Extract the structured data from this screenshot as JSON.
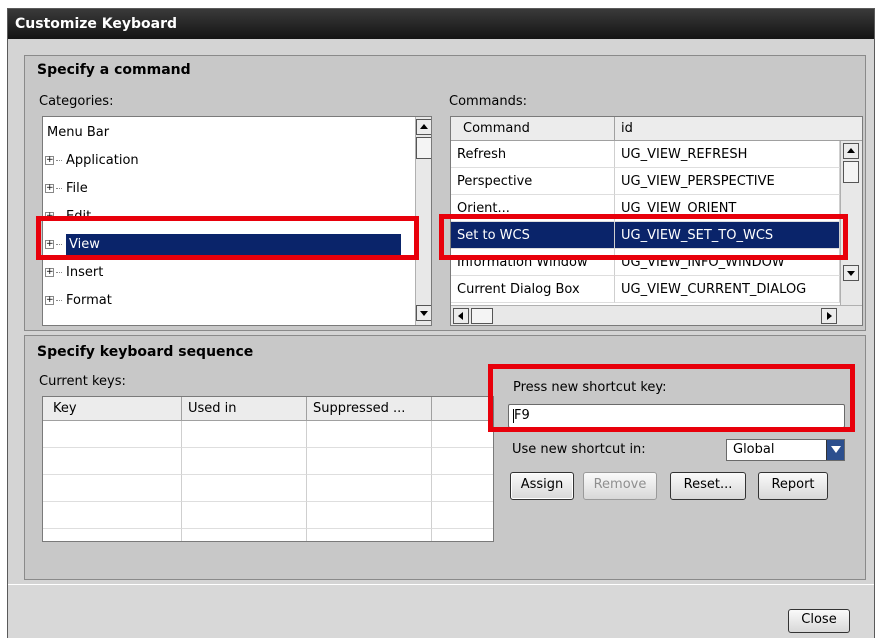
{
  "window": {
    "title": "Customize Keyboard"
  },
  "command_group": {
    "title": "Specify a command",
    "categories_label": "Categories:",
    "commands_label": "Commands:",
    "categories": [
      {
        "label": "Menu Bar",
        "expandable": false,
        "selected": false
      },
      {
        "label": "Application",
        "expandable": true,
        "selected": false
      },
      {
        "label": "File",
        "expandable": true,
        "selected": false
      },
      {
        "label": "Edit",
        "expandable": true,
        "selected": false
      },
      {
        "label": "View",
        "expandable": true,
        "selected": true
      },
      {
        "label": "Insert",
        "expandable": true,
        "selected": false
      },
      {
        "label": "Format",
        "expandable": true,
        "selected": false
      }
    ],
    "commands_columns": [
      "Command",
      "id"
    ],
    "commands": [
      {
        "command": "Refresh",
        "id": "UG_VIEW_REFRESH",
        "selected": false
      },
      {
        "command": "Perspective",
        "id": "UG_VIEW_PERSPECTIVE",
        "selected": false
      },
      {
        "command": "Orient...",
        "id": "UG_VIEW_ORIENT",
        "selected": false
      },
      {
        "command": "Set to WCS",
        "id": "UG_VIEW_SET_TO_WCS",
        "selected": true
      },
      {
        "command": "Information Window",
        "id": "UG_VIEW_INFO_WINDOW",
        "selected": false
      },
      {
        "command": "Current Dialog Box",
        "id": "UG_VIEW_CURRENT_DIALOG",
        "selected": false
      }
    ]
  },
  "keyboard_group": {
    "title": "Specify keyboard sequence",
    "current_keys_label": "Current keys:",
    "current_keys_columns": [
      "Key",
      "Used in",
      "Suppressed ..."
    ],
    "press_label": "Press new shortcut key:",
    "shortcut_value": "F9",
    "use_in_label": "Use new shortcut in:",
    "use_in_value": "Global",
    "assign_label": "Assign",
    "remove_label": "Remove",
    "reset_label": "Reset...",
    "report_label": "Report"
  },
  "footer": {
    "close_label": "Close"
  },
  "colors": {
    "selection": "#0a246a",
    "highlight_box": "#e8000b",
    "titlebar": "#1e1e1e"
  }
}
